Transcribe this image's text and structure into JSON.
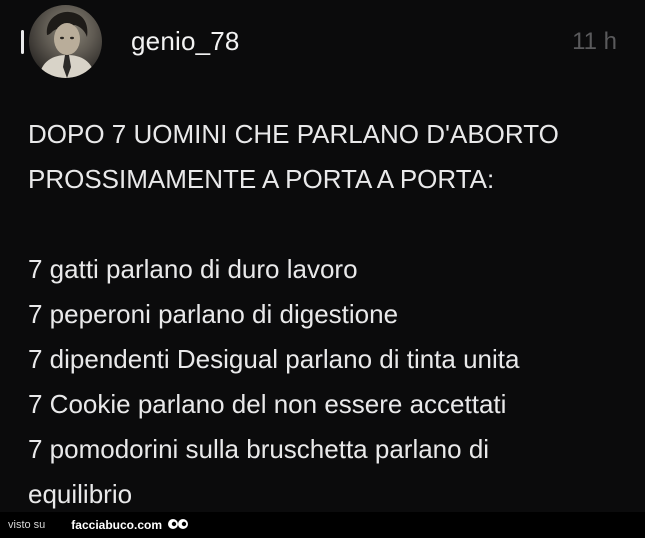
{
  "post": {
    "username": "genio_78",
    "timestamp": "11 h",
    "lines": [
      "DOPO 7 UOMINI CHE PARLANO D'ABORTO",
      "PROSSIMAMENTE A PORTA A PORTA:",
      "7 gatti parlano di duro lavoro",
      "7 peperoni parlano di digestione",
      "7 dipendenti Desigual parlano di tinta unita",
      "7 Cookie parlano del non essere accettati",
      "7 pomodorini sulla bruschetta parlano di",
      "equilibrio"
    ]
  },
  "footer": {
    "seen_on": "visto su",
    "site": "facciabuco.com",
    "logo_icon": "eyes-icon"
  },
  "icons": {
    "avatar": "profile-photo",
    "left_bar": "reply-bar"
  }
}
